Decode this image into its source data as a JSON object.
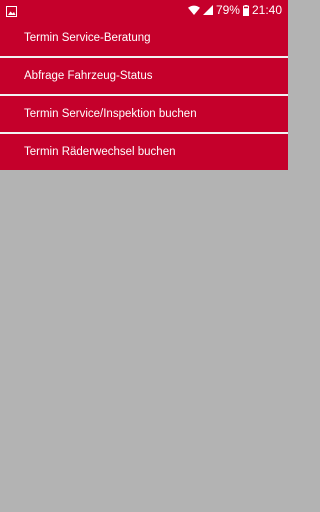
{
  "status_bar": {
    "background": "#c5002b",
    "left_icon": "image-icon",
    "icons": [
      "wifi-icon",
      "signal-icon",
      "battery-icon"
    ],
    "battery": "79%",
    "time": "21:40"
  },
  "menu": {
    "background": "#c5002b",
    "items": [
      {
        "label": "Termin Service-Beratung"
      },
      {
        "label": "Abfrage Fahrzeug-Status"
      },
      {
        "label": "Termin Service/Inspektion buchen"
      },
      {
        "label": "Termin Räderwechsel buchen"
      }
    ]
  }
}
